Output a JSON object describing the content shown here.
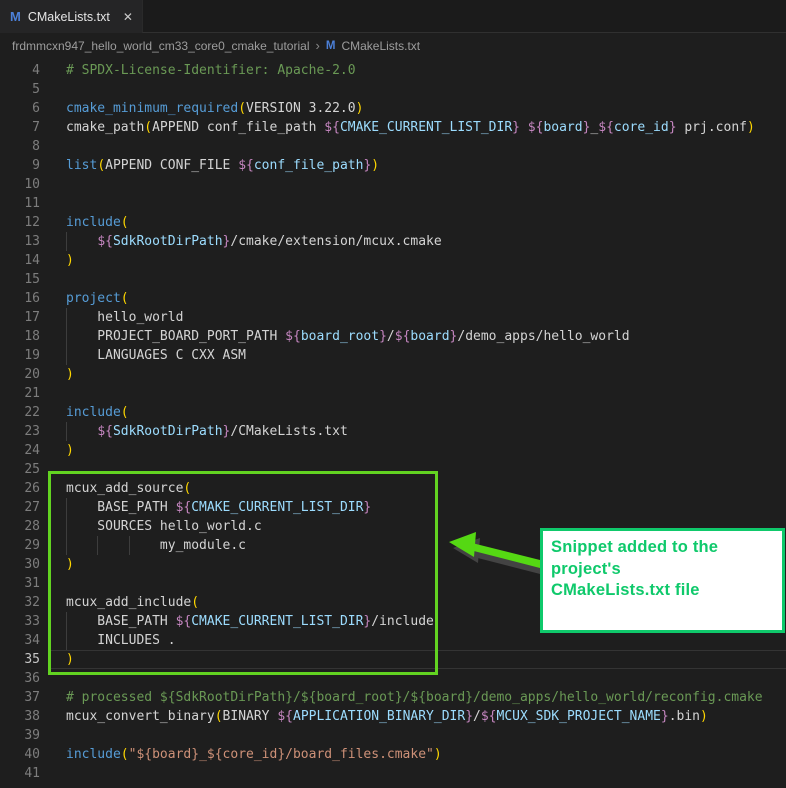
{
  "window": {
    "tab": {
      "icon": "M",
      "title": "CMakeLists.txt",
      "close_glyph": "✕"
    },
    "breadcrumb": {
      "folder": "frdmmcxn947_hello_world_cm33_core0_cmake_tutorial",
      "separator": "›",
      "file": "CMakeLists.txt"
    }
  },
  "editor": {
    "colors": {
      "background": "#1e1e1e",
      "comment": "#6a9955",
      "command": "#569cd6",
      "plain": "#d4d4d4",
      "variable": "#9cdcfe",
      "interp_brace": "#c586c0",
      "paren": "#ffd700",
      "string": "#ce9178",
      "line_number": "#7d7d7d",
      "active_line_number": "#c6c6c6"
    },
    "lines": [
      {
        "n": 4,
        "t": [
          [
            "cm",
            "# SPDX-License-Identifier: Apache-2.0"
          ]
        ]
      },
      {
        "n": 5,
        "t": []
      },
      {
        "n": 6,
        "t": [
          [
            "kw",
            "cmake_minimum_required"
          ],
          [
            "pa",
            "("
          ],
          [
            "pl",
            "VERSION 3.22.0"
          ],
          [
            "pa",
            ")"
          ]
        ]
      },
      {
        "n": 7,
        "t": [
          [
            "pl",
            "cmake_path"
          ],
          [
            "pa",
            "("
          ],
          [
            "pl",
            "APPEND conf_file_path "
          ],
          [
            "br",
            "${"
          ],
          [
            "var",
            "CMAKE_CURRENT_LIST_DIR"
          ],
          [
            "br",
            "}"
          ],
          [
            "pl",
            " "
          ],
          [
            "br",
            "${"
          ],
          [
            "var",
            "board"
          ],
          [
            "br",
            "}"
          ],
          [
            "pl",
            "_"
          ],
          [
            "br",
            "${"
          ],
          [
            "var",
            "core_id"
          ],
          [
            "br",
            "}"
          ],
          [
            "pl",
            " prj.conf"
          ],
          [
            "pa",
            ")"
          ]
        ]
      },
      {
        "n": 8,
        "t": []
      },
      {
        "n": 9,
        "t": [
          [
            "kw",
            "list"
          ],
          [
            "pa",
            "("
          ],
          [
            "pl",
            "APPEND CONF_FILE "
          ],
          [
            "br",
            "${"
          ],
          [
            "var",
            "conf_file_path"
          ],
          [
            "br",
            "}"
          ],
          [
            "pa",
            ")"
          ]
        ]
      },
      {
        "n": 10,
        "t": []
      },
      {
        "n": 11,
        "t": []
      },
      {
        "n": 12,
        "t": [
          [
            "kw",
            "include"
          ],
          [
            "pa",
            "("
          ]
        ]
      },
      {
        "n": 13,
        "g": [
          0
        ],
        "t": [
          [
            "pl",
            "    "
          ],
          [
            "br",
            "${"
          ],
          [
            "var",
            "SdkRootDirPath"
          ],
          [
            "br",
            "}"
          ],
          [
            "pl",
            "/cmake/extension/mcux.cmake"
          ]
        ]
      },
      {
        "n": 14,
        "t": [
          [
            "pa",
            ")"
          ]
        ]
      },
      {
        "n": 15,
        "t": []
      },
      {
        "n": 16,
        "t": [
          [
            "kw",
            "project"
          ],
          [
            "pa",
            "("
          ]
        ]
      },
      {
        "n": 17,
        "g": [
          0
        ],
        "t": [
          [
            "pl",
            "    hello_world"
          ]
        ]
      },
      {
        "n": 18,
        "g": [
          0
        ],
        "t": [
          [
            "pl",
            "    PROJECT_BOARD_PORT_PATH "
          ],
          [
            "br",
            "${"
          ],
          [
            "var",
            "board_root"
          ],
          [
            "br",
            "}"
          ],
          [
            "pl",
            "/"
          ],
          [
            "br",
            "${"
          ],
          [
            "var",
            "board"
          ],
          [
            "br",
            "}"
          ],
          [
            "pl",
            "/demo_apps/hello_world"
          ]
        ]
      },
      {
        "n": 19,
        "g": [
          0
        ],
        "t": [
          [
            "pl",
            "    LANGUAGES C CXX ASM"
          ]
        ]
      },
      {
        "n": 20,
        "t": [
          [
            "pa",
            ")"
          ]
        ]
      },
      {
        "n": 21,
        "t": []
      },
      {
        "n": 22,
        "t": [
          [
            "kw",
            "include"
          ],
          [
            "pa",
            "("
          ]
        ]
      },
      {
        "n": 23,
        "g": [
          0
        ],
        "t": [
          [
            "pl",
            "    "
          ],
          [
            "br",
            "${"
          ],
          [
            "var",
            "SdkRootDirPath"
          ],
          [
            "br",
            "}"
          ],
          [
            "pl",
            "/CMakeLists.txt"
          ]
        ]
      },
      {
        "n": 24,
        "t": [
          [
            "pa",
            ")"
          ]
        ]
      },
      {
        "n": 25,
        "t": []
      },
      {
        "n": 26,
        "t": [
          [
            "pl",
            "mcux_add_source"
          ],
          [
            "pa",
            "("
          ]
        ]
      },
      {
        "n": 27,
        "g": [
          0
        ],
        "t": [
          [
            "pl",
            "    BASE_PATH "
          ],
          [
            "br",
            "${"
          ],
          [
            "var",
            "CMAKE_CURRENT_LIST_DIR"
          ],
          [
            "br",
            "}"
          ]
        ]
      },
      {
        "n": 28,
        "g": [
          0
        ],
        "t": [
          [
            "pl",
            "    SOURCES hello_world.c"
          ]
        ]
      },
      {
        "n": 29,
        "g": [
          0,
          4,
          8
        ],
        "t": [
          [
            "pl",
            "            my_module.c"
          ]
        ]
      },
      {
        "n": 30,
        "t": [
          [
            "pa",
            ")"
          ]
        ]
      },
      {
        "n": 31,
        "t": []
      },
      {
        "n": 32,
        "t": [
          [
            "pl",
            "mcux_add_include"
          ],
          [
            "pa",
            "("
          ]
        ]
      },
      {
        "n": 33,
        "g": [
          0
        ],
        "t": [
          [
            "pl",
            "    BASE_PATH "
          ],
          [
            "br",
            "${"
          ],
          [
            "var",
            "CMAKE_CURRENT_LIST_DIR"
          ],
          [
            "br",
            "}"
          ],
          [
            "pl",
            "/include"
          ]
        ]
      },
      {
        "n": 34,
        "g": [
          0
        ],
        "t": [
          [
            "pl",
            "    INCLUDES ."
          ]
        ]
      },
      {
        "n": 35,
        "a": true,
        "t": [
          [
            "pa",
            ")"
          ]
        ]
      },
      {
        "n": 36,
        "t": []
      },
      {
        "n": 37,
        "t": [
          [
            "cm",
            "# processed ${SdkRootDirPath}/${board_root}/${board}/demo_apps/hello_world/reconfig.cmake"
          ]
        ]
      },
      {
        "n": 38,
        "t": [
          [
            "pl",
            "mcux_convert_binary"
          ],
          [
            "pa",
            "("
          ],
          [
            "pl",
            "BINARY "
          ],
          [
            "br",
            "${"
          ],
          [
            "var",
            "APPLICATION_BINARY_DIR"
          ],
          [
            "br",
            "}"
          ],
          [
            "pl",
            "/"
          ],
          [
            "br",
            "${"
          ],
          [
            "var",
            "MCUX_SDK_PROJECT_NAME"
          ],
          [
            "br",
            "}"
          ],
          [
            "pl",
            ".bin"
          ],
          [
            "pa",
            ")"
          ]
        ]
      },
      {
        "n": 39,
        "t": []
      },
      {
        "n": 40,
        "t": [
          [
            "kw",
            "include"
          ],
          [
            "pa",
            "("
          ],
          [
            "st",
            "\"${board}_${core_id}/board_files.cmake\""
          ],
          [
            "pa",
            ")"
          ]
        ]
      },
      {
        "n": 41,
        "t": []
      }
    ]
  },
  "annotation": {
    "highlight_box_color": "#62d321",
    "arrow_color": "#55d813",
    "callout": {
      "lines": [
        "Snippet added to the",
        "project's",
        "CMakeLists.txt file"
      ],
      "text_color": "#0fc96b",
      "border_color": "#0fc96b",
      "background": "#ffffff"
    }
  }
}
